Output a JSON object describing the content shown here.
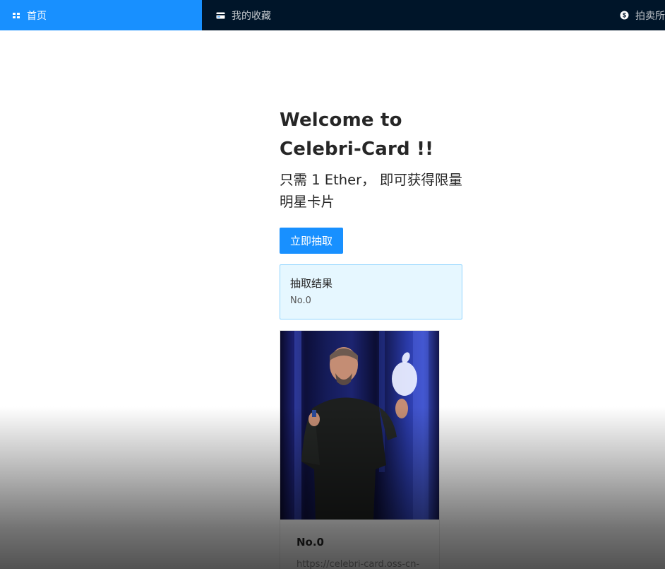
{
  "nav": {
    "items": [
      {
        "label": "首页",
        "icon": "home-icon",
        "active": true
      },
      {
        "label": "我的收藏",
        "icon": "card-icon",
        "active": false
      },
      {
        "label": "拍卖所",
        "icon": "dollar-circle-icon",
        "active": false
      }
    ]
  },
  "main": {
    "welcome": "Welcome to Celebri-Card !!",
    "subtitle": "只需 1 Ether， 即可获得限量明星卡片",
    "draw_button": "立即抽取",
    "result": {
      "title": "抽取结果",
      "value": "No.0"
    },
    "card": {
      "title": "No.0",
      "description": "https://celebri-card.oss-cn-"
    }
  },
  "colors": {
    "nav_bg": "#001529",
    "accent": "#1890ff",
    "result_bg": "#e6f7ff",
    "result_border": "#91d5ff"
  }
}
